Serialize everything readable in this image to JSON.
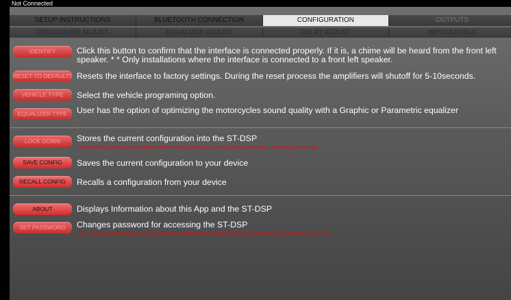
{
  "status": "Not Connected",
  "tabs_row1": [
    "SETUP INSTRUCTIONS",
    "BLUETOOTH CONNECTION",
    "CONFIGURATION",
    "OUTPUTS"
  ],
  "tabs_row2": [
    "CROSSOVER ADJUST",
    "EQUALIZER ADJUST",
    "DELAY ADJUST",
    "INPUT/LEVELS"
  ],
  "rows": {
    "identify": {
      "button": "IDENTIFY",
      "desc1": "Click this button to confirm that the interface is connected properly. If it is, a chime will be heard from the front left",
      "desc2": "speaker. * * Only installations where the interface is connected to a front left speaker."
    },
    "reset": {
      "button": "RESET TO DEFAULTS",
      "desc": "Resets the interface to factory settings. During the reset process the amplifiers will shutoff for 5-10seconds."
    },
    "vehicle": {
      "button": "VEHICLE TYPE",
      "desc": "Select the vehicle programing option."
    },
    "equalizer": {
      "button": "EQUALIZER TYPE",
      "desc": "User has the option of optimizing the motorcycles sound quality with a Graphic or Parametric equalizer",
      "sub": "."
    },
    "lockdown": {
      "button": "LOCK DOWN",
      "desc": "Stores the current configuration into the ST-DSP",
      "sub": "Attention!This button must be selected before closing the app or cycling the key, otherwise, all settings will be lost."
    },
    "save": {
      "button": "SAVE CONFIG",
      "desc": "Saves the current configuration to your device"
    },
    "recall": {
      "button": "RECALL CONFIG",
      "desc": "Recalls a configuration from your device"
    },
    "about": {
      "button": "ABOUT",
      "desc": "Displays Information about this App and the ST-DSP"
    },
    "password": {
      "button": "SET PASSWORD",
      "desc": "Changes password for accessing the ST-DSP",
      "sub": "Note: If Edge only password is lost the interface reference the interface will show. Password can be reset for the device."
    }
  }
}
